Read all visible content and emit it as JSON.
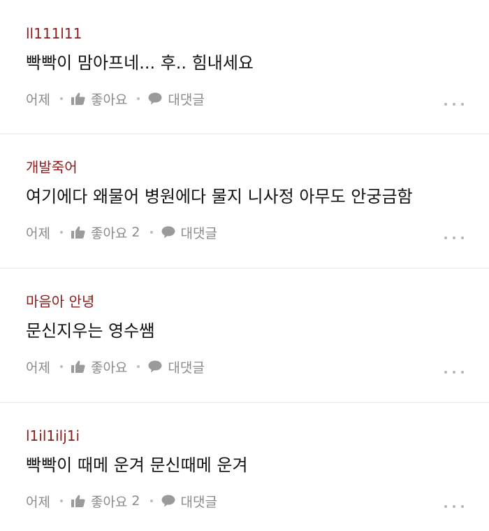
{
  "comments": [
    {
      "author": "ll111l11",
      "text": "빡빡이 맘아프네... 후.. 힘내세요",
      "time": "어제",
      "like_label": "좋아요",
      "like_count": "",
      "reply_label": "대댓글"
    },
    {
      "author": "개발죽어",
      "text": "여기에다 왜물어 병원에다 물지 니사정 아무도 안궁금함",
      "time": "어제",
      "like_label": "좋아요",
      "like_count": "2",
      "reply_label": "대댓글"
    },
    {
      "author": "마음아 안녕",
      "text": "문신지우는 영수쌤",
      "time": "어제",
      "like_label": "좋아요",
      "like_count": "",
      "reply_label": "대댓글"
    },
    {
      "author": "l1il1ilj1i",
      "text": "빡빡이 때메 운겨 문신때메 운겨",
      "time": "어제",
      "like_label": "좋아요",
      "like_count": "2",
      "reply_label": "대댓글"
    }
  ],
  "icons": {
    "like": "thumbs-up-icon",
    "reply": "speech-bubble-icon",
    "more": "more-dots-icon"
  },
  "colors": {
    "author": "#8c1a1a",
    "text": "#111111",
    "meta": "#8a8a8a",
    "divider": "#e6e6e6"
  }
}
